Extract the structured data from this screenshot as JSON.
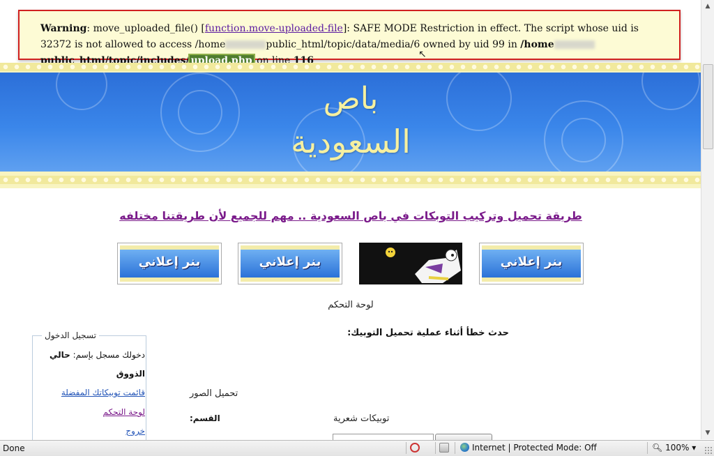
{
  "warning": {
    "label": "Warning",
    "text1": ": move_uploaded_file() [",
    "fn_link": "function.move-uploaded-file",
    "text2": "]: SAFE MODE Restriction in effect. The script whose uid is 32372 is not allowed to access /home",
    "text3": "public_html/topic/data/media/6 owned by uid 99 in ",
    "path_bold_1": "/home",
    "path_bold_2": "public_html/topic/includes/",
    "file": "upload.php",
    "on_line": " on line ",
    "line_no": "116"
  },
  "banner": {
    "title_line1": "باص",
    "title_line2": "السعودية"
  },
  "headline_link": "طريقة  تحميل وتركيب التوبكات في باص السعودية  ..  مهم للجميع لأن طريقتنا مختلفه",
  "ads": [
    "بنر إعلاني",
    "بنر إعلاني",
    "بنر إعلاني"
  ],
  "control_panel_title": "لوحة التحكم",
  "error_message": "حدث خطأ أثناء عملية تحميل التوبيك:",
  "sidebar": {
    "title": "تسجيل الدخول",
    "logged_in_as": "دخولك مسجل بإسم:",
    "username": "حالي",
    "taste": "الذووق",
    "fav_list": "قائمت توبيكاتك المفضلة",
    "control_panel": "لوحة التحكم",
    "logout": "خروج"
  },
  "upload_images_label": "تحميل الصور",
  "section_label": "القسم:",
  "section_value": "توبيكات شعرية",
  "statusbar": {
    "done": "Done",
    "zone": "Internet | Protected Mode: Off",
    "zoom": "100%"
  },
  "colors": {
    "warning_border": "#d12020",
    "warning_bg": "#fdfbd5",
    "banner_blue": "#2c6fd8",
    "banner_cream": "#f8f4c0",
    "link_purple": "#7a1a8a",
    "link_blue": "#2355b8"
  }
}
